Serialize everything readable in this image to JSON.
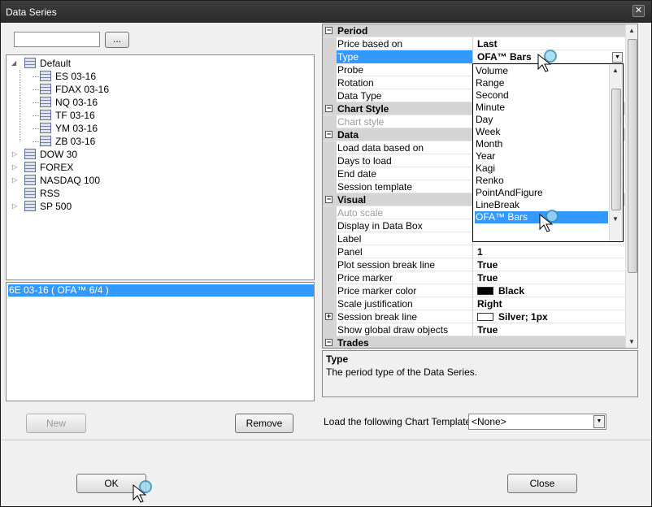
{
  "window": {
    "title": "Data Series",
    "close_glyph": "✕"
  },
  "search": {
    "value": "",
    "browse_label": "..."
  },
  "tree": {
    "default_label": "Default",
    "default_children": [
      "ES 03-16",
      "FDAX 03-16",
      "NQ 03-16",
      "TF 03-16",
      "YM 03-16",
      "ZB 03-16"
    ],
    "other_groups": [
      "DOW 30",
      "FOREX",
      "NASDAQ 100",
      "RSS",
      "SP 500"
    ]
  },
  "series_list": {
    "items": [
      "6E 03-16 ( OFA™ 6/4 )"
    ]
  },
  "buttons": {
    "new": "New",
    "remove": "Remove",
    "ok": "OK",
    "close": "Close"
  },
  "properties": {
    "period_cat": "Period",
    "price_based_on": {
      "name": "Price based on",
      "value": "Last"
    },
    "type": {
      "name": "Type",
      "value": "OFA™ Bars"
    },
    "probe": {
      "name": "Probe"
    },
    "rotation": {
      "name": "Rotation"
    },
    "data_type": {
      "name": "Data Type"
    },
    "chart_style_cat": "Chart Style",
    "chart_style": {
      "name": "Chart style"
    },
    "data_cat": "Data",
    "load_data": {
      "name": "Load data based on"
    },
    "days_to_load": {
      "name": "Days to load"
    },
    "end_date": {
      "name": "End date"
    },
    "session_template": {
      "name": "Session template"
    },
    "visual_cat": "Visual",
    "auto_scale": {
      "name": "Auto scale"
    },
    "display_in_data_box": {
      "name": "Display in Data Box"
    },
    "label": {
      "name": "Label"
    },
    "panel": {
      "name": "Panel",
      "value": "1"
    },
    "plot_session_break": {
      "name": "Plot session break line",
      "value": "True"
    },
    "price_marker": {
      "name": "Price marker",
      "value": "True"
    },
    "price_marker_color": {
      "name": "Price marker color",
      "value": "Black",
      "color": "#000000"
    },
    "scale_justification": {
      "name": "Scale justification",
      "value": "Right"
    },
    "session_break_line": {
      "name": "Session break line",
      "value": "Silver; 1px",
      "color": "#ffffff"
    },
    "show_global_draw": {
      "name": "Show global draw objects",
      "value": "True"
    },
    "trades_cat": "Trades"
  },
  "type_dropdown": {
    "options": [
      "Volume",
      "Range",
      "Second",
      "Minute",
      "Day",
      "Week",
      "Month",
      "Year",
      "Kagi",
      "Renko",
      "PointAndFigure",
      "LineBreak",
      "OFA™ Bars"
    ],
    "selected": "OFA™ Bars"
  },
  "description": {
    "title": "Type",
    "text": "The period type of the Data Series."
  },
  "template": {
    "label": "Load the following Chart Template:",
    "value": "<None>"
  },
  "colors": {
    "selection": "#3399ff",
    "category_bg": "#d4d4d4"
  }
}
